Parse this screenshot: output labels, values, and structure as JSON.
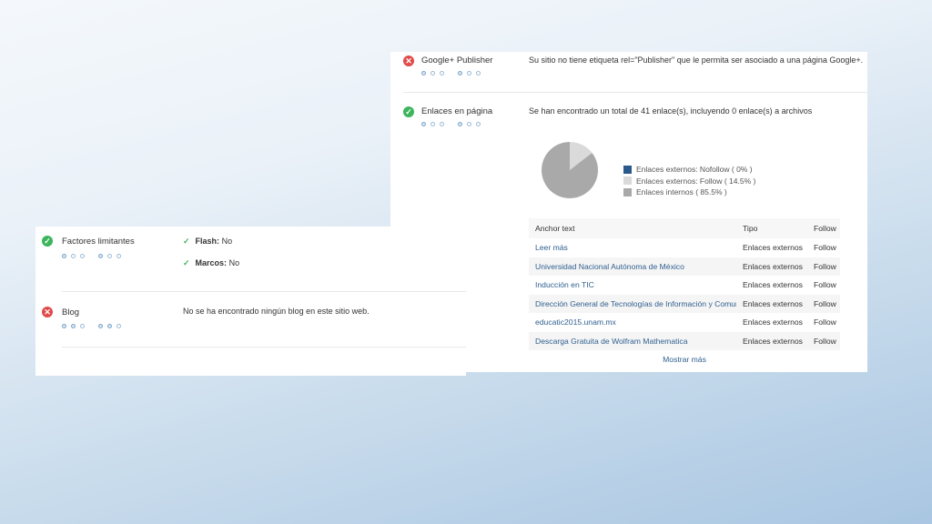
{
  "right_panel": {
    "google_publisher": {
      "label": "Google+ Publisher",
      "status": "error",
      "message": "Su sitio no tiene etiqueta rel=\"Publisher\" que le permita ser asociado a una página Google+."
    },
    "enlaces": {
      "label": "Enlaces en página",
      "status": "ok",
      "message": "Se han encontrado un total de 41 enlace(s), incluyendo 0 enlace(s) a archivos",
      "chart_data": {
        "type": "pie",
        "series": [
          {
            "name": "Enlaces externos: Nofollow ( 0% )",
            "value": 0,
            "color": "#2b5a8a"
          },
          {
            "name": "Enlaces externos: Follow ( 14.5% )",
            "value": 14.5,
            "color": "#dadada"
          },
          {
            "name": "Enlaces internos ( 85.5% )",
            "value": 85.5,
            "color": "#a9a9a9"
          }
        ]
      },
      "table": {
        "headers": [
          "Anchor text",
          "Tipo",
          "Follow"
        ],
        "rows": [
          [
            "Leer más",
            "Enlaces externos",
            "Follow"
          ],
          [
            "Universidad Nacional Autónoma de México",
            "Enlaces externos",
            "Follow"
          ],
          [
            "Inducción en TIC",
            "Enlaces externos",
            "Follow"
          ],
          [
            "Dirección General de Tecnologías de Información y Comunicación",
            "Enlaces externos",
            "Follow"
          ],
          [
            "educatic2015.unam.mx",
            "Enlaces externos",
            "Follow"
          ],
          [
            "Descarga Gratuita de Wolfram Mathematica",
            "Enlaces externos",
            "Follow"
          ]
        ]
      },
      "more_label": "Mostrar más"
    }
  },
  "left_panel": {
    "factores": {
      "label": "Factores limitantes",
      "status": "ok",
      "flash_label": "Flash:",
      "flash_value": "No",
      "marcos_label": "Marcos:",
      "marcos_value": "No"
    },
    "blog": {
      "label": "Blog",
      "status": "error",
      "message": "No se ha encontrado ningún blog en este sitio web."
    }
  },
  "icons": {
    "ok": "check-circle-icon",
    "error": "x-circle-icon"
  },
  "colors": {
    "ok": "#3cb55c",
    "error": "#e04b4b",
    "link": "#2f5f8f"
  }
}
